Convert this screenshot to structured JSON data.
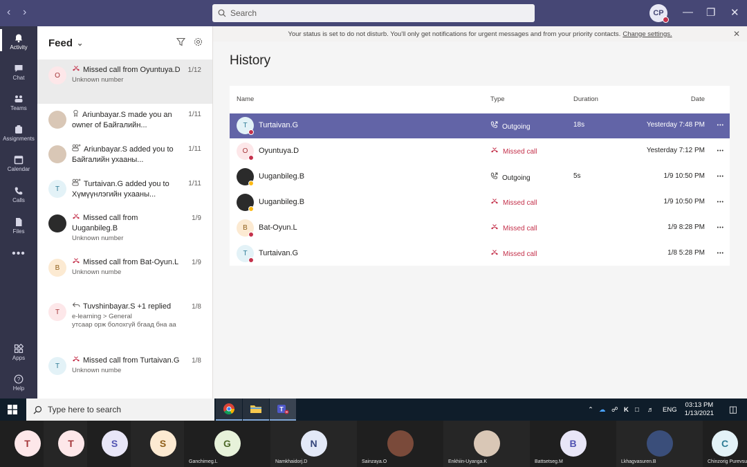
{
  "titlebar": {
    "back_icon": "chevron-left-icon",
    "forward_icon": "chevron-right-icon",
    "search_placeholder": "Search",
    "avatar_initials": "CP"
  },
  "rail": [
    {
      "label": "Activity",
      "icon": "bell-icon",
      "active": true
    },
    {
      "label": "Chat",
      "icon": "chat-icon"
    },
    {
      "label": "Teams",
      "icon": "teams-icon"
    },
    {
      "label": "Assignments",
      "icon": "assignments-icon"
    },
    {
      "label": "Calendar",
      "icon": "calendar-icon"
    },
    {
      "label": "Calls",
      "icon": "phone-icon"
    },
    {
      "label": "Files",
      "icon": "files-icon"
    },
    {
      "label": "Apps",
      "icon": "apps-icon"
    },
    {
      "label": "Help",
      "icon": "help-icon"
    }
  ],
  "feed": {
    "title": "Feed",
    "items": [
      {
        "initial": "O",
        "icon": "missed-call-icon",
        "title": "Missed call from Oyuntuya.D",
        "sub": "Unknown number",
        "date": "1/12",
        "avatar_bg": "#fde7e9",
        "avatar_fg": "#a4373a",
        "status": "#c4314b",
        "selected": true
      },
      {
        "initial": "",
        "icon": "owner-icon",
        "title": "Ariunbayar.S made you an owner of Байгалийн...",
        "sub": "",
        "date": "1/11",
        "avatar_bg": "#d9c7b6",
        "avatar_fg": "#5b4636",
        "status": "#c8c6c4"
      },
      {
        "initial": "",
        "icon": "add-member-icon",
        "title": "Ariunbayar.S added you to Байгалийн ухааны...",
        "sub": "",
        "date": "1/11",
        "avatar_bg": "#d9c7b6",
        "avatar_fg": "#5b4636",
        "status": "#c8c6c4"
      },
      {
        "initial": "T",
        "icon": "add-member-icon",
        "title": "Turtaivan.G added you to Хүмүүнлэгийн ухааны...",
        "sub": "",
        "date": "1/11",
        "avatar_bg": "#e3f2f7",
        "avatar_fg": "#2f7c96",
        "status": "#c4314b"
      },
      {
        "initial": "",
        "icon": "missed-call-icon",
        "title": "Missed call from Uuganbileg.B",
        "sub": "Unknown number",
        "date": "1/9",
        "avatar_bg": "#2b2b2b",
        "avatar_fg": "#fff",
        "status": "#fdb913"
      },
      {
        "initial": "B",
        "icon": "missed-call-icon",
        "title": "Missed call from Bat-Oyun.L",
        "sub": "Unknown numbe",
        "date": "1/9",
        "avatar_bg": "#fcead2",
        "avatar_fg": "#8f5f1a",
        "status": "#c4314b"
      },
      {
        "initial": "T",
        "icon": "reply-icon",
        "title": "Tuvshinbayar.S +1 replied",
        "sub": "e-learning > General",
        "sub2": "утсаар орж болохгүй бгаад бна аа",
        "date": "1/8",
        "avatar_bg": "#fde7e9",
        "avatar_fg": "#a4373a",
        "status": "#c4314b"
      },
      {
        "initial": "T",
        "icon": "missed-call-icon",
        "title": "Missed call from Turtaivan.G",
        "sub": "Unknown numbe",
        "date": "1/8",
        "avatar_bg": "#e3f2f7",
        "avatar_fg": "#2f7c96",
        "status": "#c4314b"
      }
    ]
  },
  "notification": {
    "text": "Your status is set to do not disturb. You'll only get notifications for urgent messages and from your priority contacts.",
    "link": "Change settings."
  },
  "history": {
    "title": "History",
    "columns": {
      "name": "Name",
      "type": "Type",
      "duration": "Duration",
      "date": "Date"
    },
    "rows": [
      {
        "initial": "T",
        "name": "Turtaivan.G",
        "type": "Outgoing",
        "missed": false,
        "duration": "18s",
        "date": "Yesterday 7:48 PM",
        "selected": true,
        "avatar_bg": "#e3f2f7",
        "avatar_fg": "#2f7c96",
        "status": "#c4314b"
      },
      {
        "initial": "O",
        "name": "Oyuntuya.D",
        "type": "Missed call",
        "missed": true,
        "duration": "",
        "date": "Yesterday 7:12 PM",
        "avatar_bg": "#fde7e9",
        "avatar_fg": "#a4373a",
        "status": "#c4314b"
      },
      {
        "initial": "",
        "name": "Uuganbileg.B",
        "type": "Outgoing",
        "missed": false,
        "duration": "5s",
        "date": "1/9 10:50 PM",
        "avatar_bg": "#2b2b2b",
        "avatar_fg": "#fff",
        "status": "#fdb913"
      },
      {
        "initial": "",
        "name": "Uuganbileg.B",
        "type": "Missed call",
        "missed": true,
        "duration": "",
        "date": "1/9 10:50 PM",
        "avatar_bg": "#2b2b2b",
        "avatar_fg": "#fff",
        "status": "#fdb913"
      },
      {
        "initial": "B",
        "name": "Bat-Oyun.L",
        "type": "Missed call",
        "missed": true,
        "duration": "",
        "date": "1/9 8:28 PM",
        "avatar_bg": "#fcead2",
        "avatar_fg": "#8f5f1a",
        "status": "#c4314b"
      },
      {
        "initial": "T",
        "name": "Turtaivan.G",
        "type": "Missed call",
        "missed": true,
        "duration": "",
        "date": "1/8 5:28 PM",
        "avatar_bg": "#e3f2f7",
        "avatar_fg": "#2f7c96",
        "status": "#c4314b"
      }
    ]
  },
  "taskbar": {
    "search_placeholder": "Type here to search",
    "lang": "ENG",
    "time": "03:13 PM",
    "date": "1/13/2021"
  },
  "meeting": {
    "tiles": [
      {
        "initial": "T",
        "name": "",
        "bg": "#fde7e9",
        "fg": "#a4373a"
      },
      {
        "initial": "T",
        "name": "",
        "bg": "#fde7e9",
        "fg": "#a4373a"
      },
      {
        "initial": "S",
        "name": "",
        "bg": "#e8e6f7",
        "fg": "#4f52b2"
      },
      {
        "initial": "S",
        "name": "",
        "bg": "#fcead2",
        "fg": "#8f5f1a"
      },
      {
        "initial": "G",
        "name": "Ganchimeg.L",
        "bg": "#e7f2da",
        "fg": "#4f6b2a"
      },
      {
        "initial": "N",
        "name": "Namkhaidorj.D",
        "bg": "#e3e9f7",
        "fg": "#33447a"
      },
      {
        "initial": "",
        "name": "Sainzaya.O",
        "bg": "#7a4a3a",
        "fg": "#fff"
      },
      {
        "initial": "",
        "name": "Enkhiin-Uyanga.K",
        "bg": "#d9c7b6",
        "fg": "#5b4636"
      },
      {
        "initial": "B",
        "name": "Battsetseg.M",
        "bg": "#e8e6f7",
        "fg": "#4f52b2"
      },
      {
        "initial": "",
        "name": "Lkhagvasuren.B",
        "bg": "#3a4e7a",
        "fg": "#fff"
      },
      {
        "initial": "C",
        "name": "Chinzorig Purevsu",
        "bg": "#e3f2f7",
        "fg": "#2f7c96"
      }
    ]
  }
}
